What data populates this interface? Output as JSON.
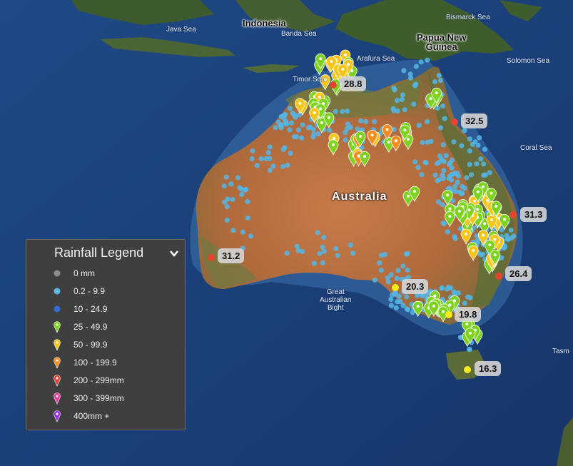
{
  "map": {
    "places": {
      "indonesia": "Indonesia",
      "java_sea": "Java Sea",
      "banda_sea": "Banda Sea",
      "bismarck_sea": "Bismarck Sea",
      "png": "Papua New\nGuinea",
      "arafura_sea": "Arafura Sea",
      "timor_sea": "Timor Sea",
      "solomon_sea": "Solomon Sea",
      "coral_sea": "Coral Sea",
      "australia": "Australia",
      "great_australian_bight": "Great\nAustralian\nBight",
      "tasman": "Tasm"
    },
    "readings": [
      {
        "value": "28.8",
        "color": "#e8432f"
      },
      {
        "value": "32.5",
        "color": "#e8432f"
      },
      {
        "value": "31.3",
        "color": "#e8432f"
      },
      {
        "value": "31.2",
        "color": "#e8432f"
      },
      {
        "value": "26.4",
        "color": "#e8432f"
      },
      {
        "value": "20.3",
        "color": "#f6ea1a"
      },
      {
        "value": "19.8",
        "color": "#f6ea1a"
      },
      {
        "value": "16.3",
        "color": "#f6ea1a"
      }
    ],
    "colors": {
      "ocean": "#1d3f78",
      "land_desert": "#b86d3f",
      "land_green": "#5a6d36",
      "light_blue_dot": "#54b6e6",
      "green_pin": "#7ed321",
      "yellow_pin": "#f5c518",
      "orange_pin": "#f28c1c"
    }
  },
  "legend": {
    "title": "Rainfall Legend",
    "toggle_icon": "chevron-down-icon",
    "items": [
      {
        "label": "0 mm",
        "color": "#8c8c8c",
        "shape": "dot"
      },
      {
        "label": "0.2 - 9.9",
        "color": "#5bb7e5",
        "shape": "dot"
      },
      {
        "label": "10 - 24.9",
        "color": "#2f6fd6",
        "shape": "dot"
      },
      {
        "label": "25 - 49.9",
        "color": "#7ed321",
        "shape": "pin"
      },
      {
        "label": "50 - 99.9",
        "color": "#f5c518",
        "shape": "pin"
      },
      {
        "label": "100 - 199.9",
        "color": "#f28c1c",
        "shape": "pin"
      },
      {
        "label": "200 - 299mm",
        "color": "#e8432f",
        "shape": "pin"
      },
      {
        "label": "300 - 399mm",
        "color": "#e83aa0",
        "shape": "pin"
      },
      {
        "label": "400mm +",
        "color": "#9b30e8",
        "shape": "pin"
      }
    ]
  }
}
